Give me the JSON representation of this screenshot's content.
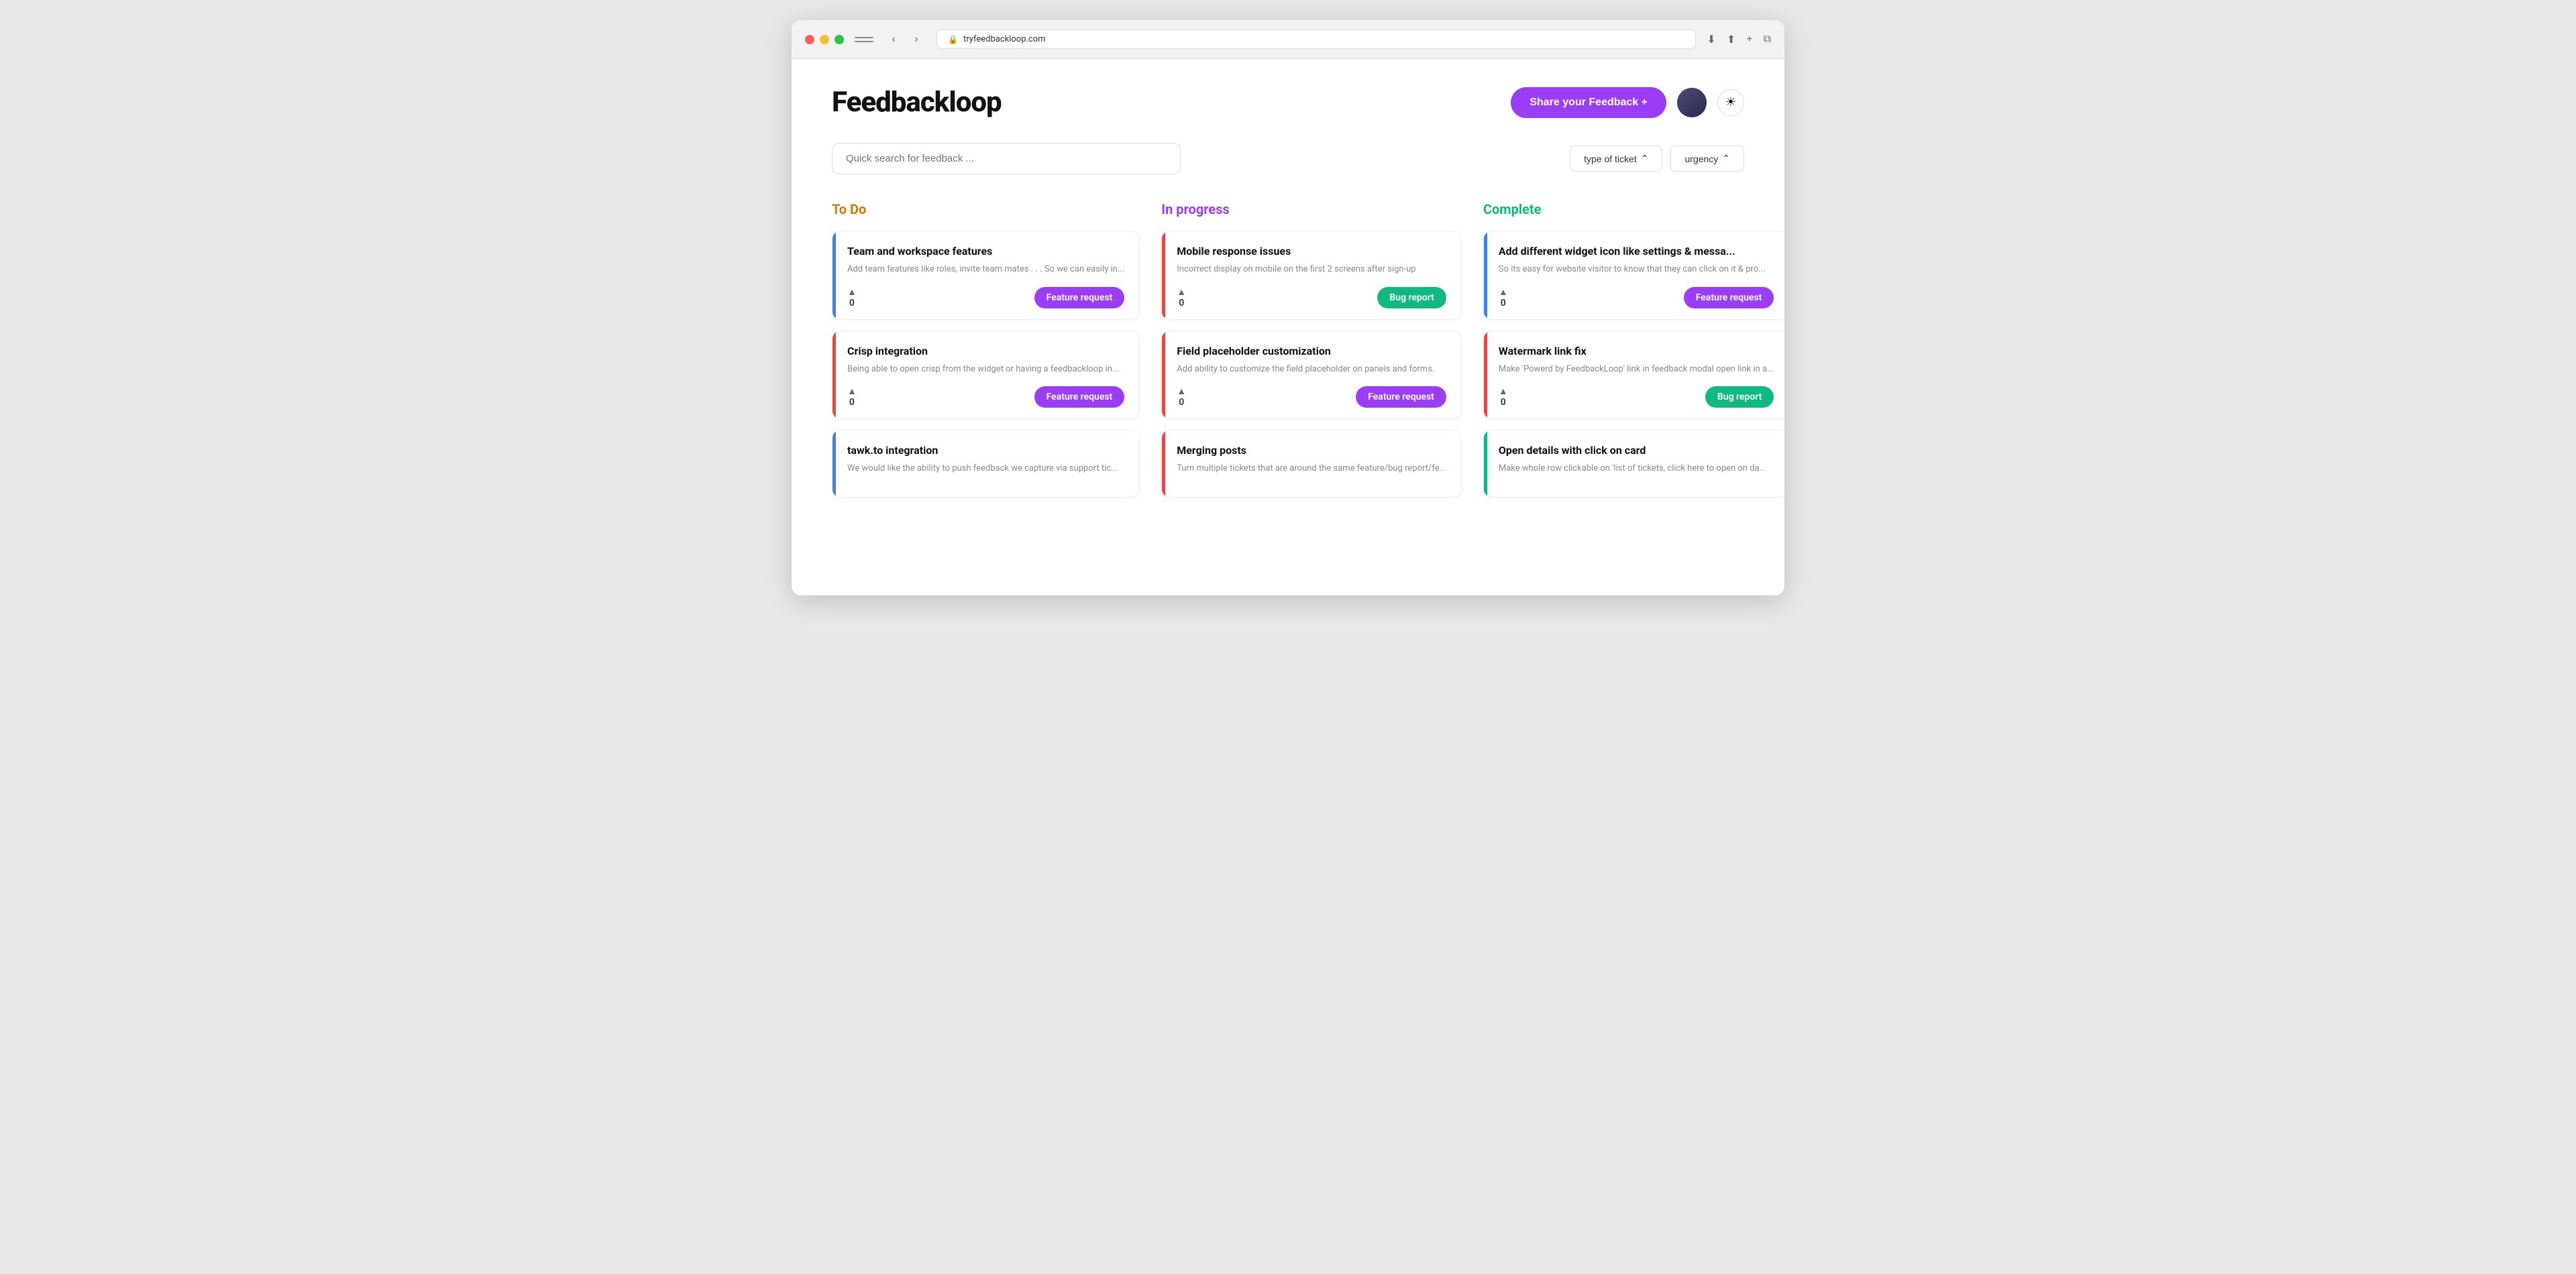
{
  "browser": {
    "url": "tryfeedbackloop.com",
    "back_label": "‹",
    "forward_label": "›"
  },
  "header": {
    "title": "Feedbackloop",
    "share_btn_label": "Share your Feedback  +",
    "theme_icon": "☀",
    "avatar_label": "User Avatar"
  },
  "search": {
    "placeholder": "Quick search for feedback ...",
    "filter_ticket_label": "type of ticket",
    "filter_urgency_label": "urgency",
    "chevron": "⌃"
  },
  "columns": [
    {
      "id": "todo",
      "label": "To Do",
      "cards": [
        {
          "title": "Team and workspace features",
          "desc": "Add team features like roles, invite team mates . . . So we can easily in...",
          "votes": 0,
          "tag": "Feature request",
          "tag_type": "feature",
          "border": "blue"
        },
        {
          "title": "Crisp integration",
          "desc": "Being able to open crisp from the widget or having a feedbackloop in...",
          "votes": 0,
          "tag": "Feature request",
          "tag_type": "feature",
          "border": "red"
        },
        {
          "title": "tawk.to integration",
          "desc": "We would like the ability to push feedback we capture via support tic...",
          "votes": 0,
          "tag": null,
          "tag_type": null,
          "border": "blue",
          "partial": true
        }
      ]
    },
    {
      "id": "inprogress",
      "label": "In progress",
      "cards": [
        {
          "title": "Mobile response issues",
          "desc": "Incorrect display on mobile on the first 2 screens after sign-up",
          "votes": 0,
          "tag": "Bug report",
          "tag_type": "bug",
          "border": "red"
        },
        {
          "title": "Field placeholder customization",
          "desc": "Add ability to customize the field placeholder on panels and forms.",
          "votes": 0,
          "tag": "Feature request",
          "tag_type": "feature",
          "border": "red"
        },
        {
          "title": "Merging posts",
          "desc": "Turn multiple tickets that are around the same feature/bug report/fe...",
          "votes": 0,
          "tag": null,
          "tag_type": null,
          "border": "red",
          "partial": true
        }
      ]
    },
    {
      "id": "complete",
      "label": "Complete",
      "cards": [
        {
          "title": "Add different widget icon like settings & messa...",
          "desc": "So its easy for website visitor to know that they can click on it & pro...",
          "votes": 0,
          "tag": "Feature request",
          "tag_type": "feature",
          "border": "blue"
        },
        {
          "title": "Watermark link fix",
          "desc": "Make 'Powerd by FeedbackLoop' link in feedback modal open link in a...",
          "votes": 0,
          "tag": "Bug report",
          "tag_type": "bug",
          "border": "red"
        },
        {
          "title": "Open details with click on card",
          "desc": "Make whole row clickable on 'list of tickets, click here to open on da...",
          "votes": 0,
          "tag": null,
          "tag_type": null,
          "border": "green",
          "partial": true
        }
      ]
    }
  ]
}
